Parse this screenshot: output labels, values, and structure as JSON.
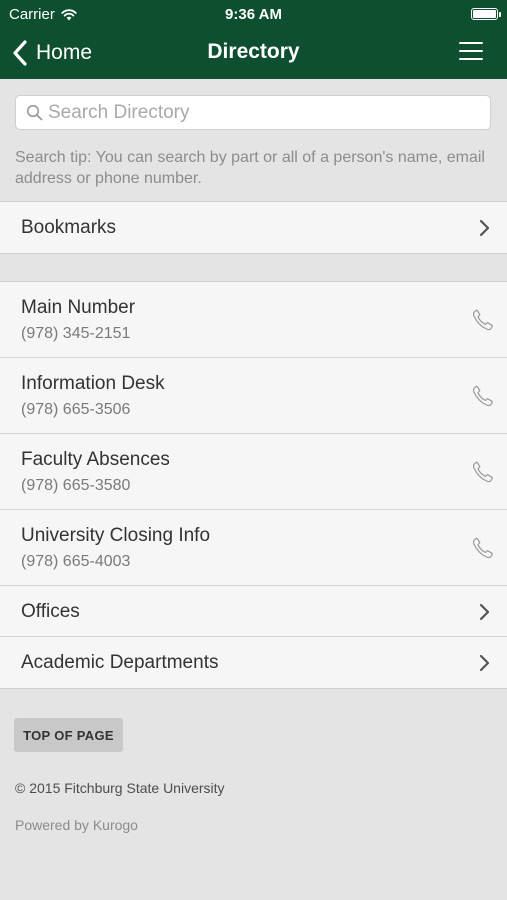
{
  "status_bar": {
    "carrier": "Carrier",
    "time": "9:36 AM"
  },
  "nav": {
    "back_label": "Home",
    "title": "Directory"
  },
  "search": {
    "placeholder": "Search Directory",
    "value": "",
    "tip": "Search tip: You can search by part or all of a person's name, email address or phone number."
  },
  "bookmarks": {
    "label": "Bookmarks"
  },
  "contacts": [
    {
      "title": "Main Number",
      "phone": "(978) 345-2151"
    },
    {
      "title": "Information Desk",
      "phone": "(978) 665-3506"
    },
    {
      "title": "Faculty Absences",
      "phone": "(978) 665-3580"
    },
    {
      "title": "University Closing Info",
      "phone": "(978) 665-4003"
    }
  ],
  "sections": [
    {
      "label": "Offices"
    },
    {
      "label": "Academic Departments"
    }
  ],
  "footer": {
    "top_button": "TOP OF PAGE",
    "copyright": "© 2015 Fitchburg State University",
    "powered_by": "Powered by Kurogo"
  },
  "colors": {
    "header": "#0d4f2e",
    "background": "#e4e4e4",
    "row": "#f6f6f6"
  },
  "icons": {
    "back": "chevron-left-icon",
    "menu": "hamburger-menu-icon",
    "search": "search-icon",
    "phone": "phone-icon",
    "chevron": "chevron-right-icon",
    "wifi": "wifi-icon",
    "battery": "battery-icon"
  }
}
